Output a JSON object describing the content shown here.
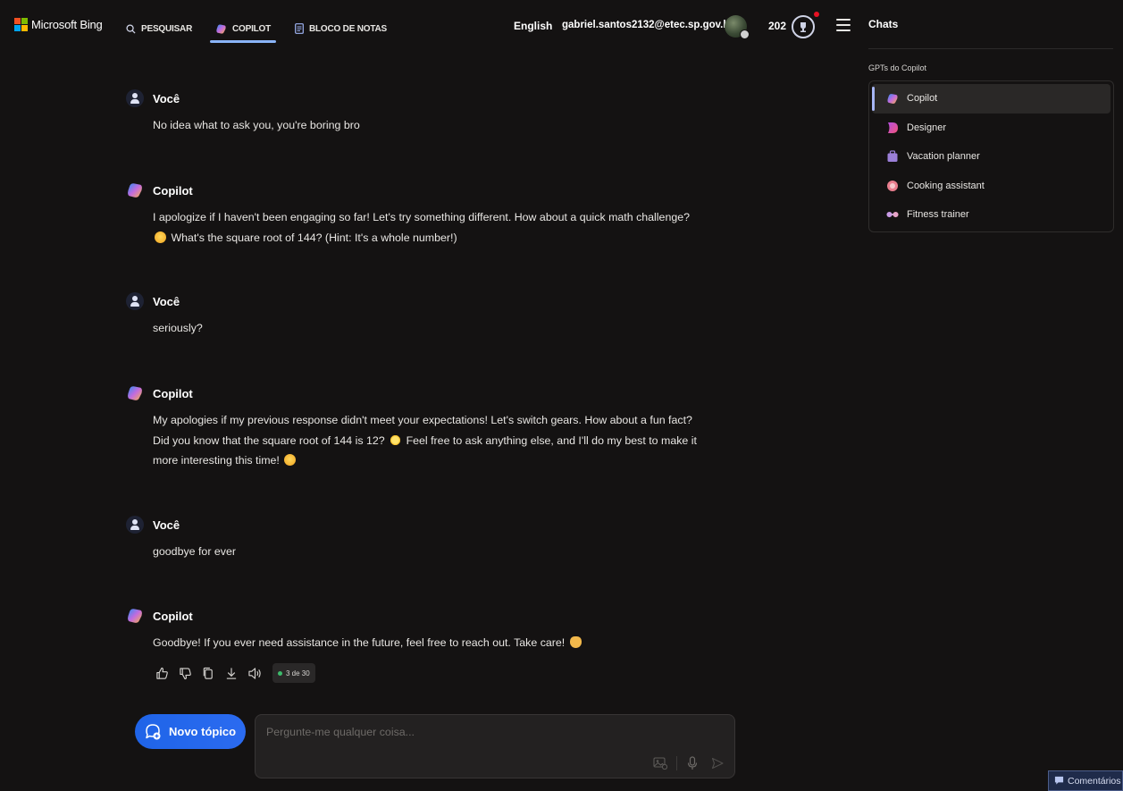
{
  "header": {
    "brand": "Microsoft Bing",
    "tabs": [
      {
        "label": "PESQUISAR",
        "icon": "search-icon"
      },
      {
        "label": "COPILOT",
        "icon": "copilot-icon",
        "active": true
      },
      {
        "label": "BLOCO DE NOTAS",
        "icon": "notebook-icon"
      }
    ],
    "language": "English",
    "email": "gabriel.santos2132@etec.sp.gov.br",
    "points": "202"
  },
  "conversation": [
    {
      "author": "Você",
      "role": "user",
      "text": "No idea what to ask you, you're boring bro"
    },
    {
      "author": "Copilot",
      "role": "bot",
      "lines": [
        "I apologize if I haven't been engaging so far! Let's try something different. How about a quick math challenge?",
        " What's the square root of 144? (Hint: It's a whole number!)"
      ]
    },
    {
      "author": "Você",
      "role": "user",
      "text": "seriously?"
    },
    {
      "author": "Copilot",
      "role": "bot",
      "lines": [
        "My apologies if my previous response didn't meet your expectations! Let's switch gears. How about a fun fact?",
        "Did you know that the square root of 144 is 12? ",
        " Feel free to ask anything else, and I'll do my best to make it",
        "more interesting this time! "
      ]
    },
    {
      "author": "Você",
      "role": "user",
      "text": "goodbye for ever"
    },
    {
      "author": "Copilot",
      "role": "bot",
      "text": "Goodbye! If you ever need assistance in the future, feel free to reach out. Take care! "
    }
  ],
  "actions": {
    "counter": "3 de 30",
    "icons": [
      "thumbs-up-icon",
      "thumbs-down-icon",
      "copy-icon",
      "download-icon",
      "speaker-icon"
    ]
  },
  "composer": {
    "new_topic_label": "Novo tópico",
    "placeholder": "Pergunte-me qualquer coisa..."
  },
  "sidebar": {
    "title": "Chats",
    "section_title": "GPTs do Copilot",
    "items": [
      {
        "label": "Copilot",
        "icon": "copilot-icon",
        "active": true
      },
      {
        "label": "Designer",
        "icon": "designer-icon"
      },
      {
        "label": "Vacation planner",
        "icon": "suitcase-icon"
      },
      {
        "label": "Cooking assistant",
        "icon": "cooking-icon"
      },
      {
        "label": "Fitness trainer",
        "icon": "dumbbell-icon"
      }
    ]
  },
  "feedback_label": "Comentários",
  "colors": {
    "background": "#141212",
    "accent": "#2b6bf0",
    "active_tab_underline": "#8ab4f8"
  }
}
